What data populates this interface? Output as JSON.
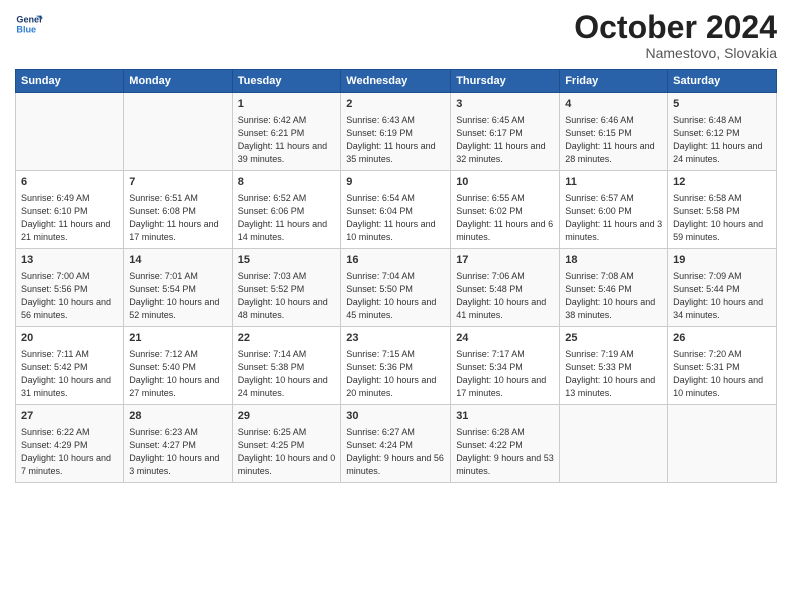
{
  "header": {
    "logo_line1": "General",
    "logo_line2": "Blue",
    "month": "October 2024",
    "location": "Namestovo, Slovakia"
  },
  "days_of_week": [
    "Sunday",
    "Monday",
    "Tuesday",
    "Wednesday",
    "Thursday",
    "Friday",
    "Saturday"
  ],
  "weeks": [
    [
      {
        "day": "",
        "sunrise": "",
        "sunset": "",
        "daylight": ""
      },
      {
        "day": "",
        "sunrise": "",
        "sunset": "",
        "daylight": ""
      },
      {
        "day": "1",
        "sunrise": "Sunrise: 6:42 AM",
        "sunset": "Sunset: 6:21 PM",
        "daylight": "Daylight: 11 hours and 39 minutes."
      },
      {
        "day": "2",
        "sunrise": "Sunrise: 6:43 AM",
        "sunset": "Sunset: 6:19 PM",
        "daylight": "Daylight: 11 hours and 35 minutes."
      },
      {
        "day": "3",
        "sunrise": "Sunrise: 6:45 AM",
        "sunset": "Sunset: 6:17 PM",
        "daylight": "Daylight: 11 hours and 32 minutes."
      },
      {
        "day": "4",
        "sunrise": "Sunrise: 6:46 AM",
        "sunset": "Sunset: 6:15 PM",
        "daylight": "Daylight: 11 hours and 28 minutes."
      },
      {
        "day": "5",
        "sunrise": "Sunrise: 6:48 AM",
        "sunset": "Sunset: 6:12 PM",
        "daylight": "Daylight: 11 hours and 24 minutes."
      }
    ],
    [
      {
        "day": "6",
        "sunrise": "Sunrise: 6:49 AM",
        "sunset": "Sunset: 6:10 PM",
        "daylight": "Daylight: 11 hours and 21 minutes."
      },
      {
        "day": "7",
        "sunrise": "Sunrise: 6:51 AM",
        "sunset": "Sunset: 6:08 PM",
        "daylight": "Daylight: 11 hours and 17 minutes."
      },
      {
        "day": "8",
        "sunrise": "Sunrise: 6:52 AM",
        "sunset": "Sunset: 6:06 PM",
        "daylight": "Daylight: 11 hours and 14 minutes."
      },
      {
        "day": "9",
        "sunrise": "Sunrise: 6:54 AM",
        "sunset": "Sunset: 6:04 PM",
        "daylight": "Daylight: 11 hours and 10 minutes."
      },
      {
        "day": "10",
        "sunrise": "Sunrise: 6:55 AM",
        "sunset": "Sunset: 6:02 PM",
        "daylight": "Daylight: 11 hours and 6 minutes."
      },
      {
        "day": "11",
        "sunrise": "Sunrise: 6:57 AM",
        "sunset": "Sunset: 6:00 PM",
        "daylight": "Daylight: 11 hours and 3 minutes."
      },
      {
        "day": "12",
        "sunrise": "Sunrise: 6:58 AM",
        "sunset": "Sunset: 5:58 PM",
        "daylight": "Daylight: 10 hours and 59 minutes."
      }
    ],
    [
      {
        "day": "13",
        "sunrise": "Sunrise: 7:00 AM",
        "sunset": "Sunset: 5:56 PM",
        "daylight": "Daylight: 10 hours and 56 minutes."
      },
      {
        "day": "14",
        "sunrise": "Sunrise: 7:01 AM",
        "sunset": "Sunset: 5:54 PM",
        "daylight": "Daylight: 10 hours and 52 minutes."
      },
      {
        "day": "15",
        "sunrise": "Sunrise: 7:03 AM",
        "sunset": "Sunset: 5:52 PM",
        "daylight": "Daylight: 10 hours and 48 minutes."
      },
      {
        "day": "16",
        "sunrise": "Sunrise: 7:04 AM",
        "sunset": "Sunset: 5:50 PM",
        "daylight": "Daylight: 10 hours and 45 minutes."
      },
      {
        "day": "17",
        "sunrise": "Sunrise: 7:06 AM",
        "sunset": "Sunset: 5:48 PM",
        "daylight": "Daylight: 10 hours and 41 minutes."
      },
      {
        "day": "18",
        "sunrise": "Sunrise: 7:08 AM",
        "sunset": "Sunset: 5:46 PM",
        "daylight": "Daylight: 10 hours and 38 minutes."
      },
      {
        "day": "19",
        "sunrise": "Sunrise: 7:09 AM",
        "sunset": "Sunset: 5:44 PM",
        "daylight": "Daylight: 10 hours and 34 minutes."
      }
    ],
    [
      {
        "day": "20",
        "sunrise": "Sunrise: 7:11 AM",
        "sunset": "Sunset: 5:42 PM",
        "daylight": "Daylight: 10 hours and 31 minutes."
      },
      {
        "day": "21",
        "sunrise": "Sunrise: 7:12 AM",
        "sunset": "Sunset: 5:40 PM",
        "daylight": "Daylight: 10 hours and 27 minutes."
      },
      {
        "day": "22",
        "sunrise": "Sunrise: 7:14 AM",
        "sunset": "Sunset: 5:38 PM",
        "daylight": "Daylight: 10 hours and 24 minutes."
      },
      {
        "day": "23",
        "sunrise": "Sunrise: 7:15 AM",
        "sunset": "Sunset: 5:36 PM",
        "daylight": "Daylight: 10 hours and 20 minutes."
      },
      {
        "day": "24",
        "sunrise": "Sunrise: 7:17 AM",
        "sunset": "Sunset: 5:34 PM",
        "daylight": "Daylight: 10 hours and 17 minutes."
      },
      {
        "day": "25",
        "sunrise": "Sunrise: 7:19 AM",
        "sunset": "Sunset: 5:33 PM",
        "daylight": "Daylight: 10 hours and 13 minutes."
      },
      {
        "day": "26",
        "sunrise": "Sunrise: 7:20 AM",
        "sunset": "Sunset: 5:31 PM",
        "daylight": "Daylight: 10 hours and 10 minutes."
      }
    ],
    [
      {
        "day": "27",
        "sunrise": "Sunrise: 6:22 AM",
        "sunset": "Sunset: 4:29 PM",
        "daylight": "Daylight: 10 hours and 7 minutes."
      },
      {
        "day": "28",
        "sunrise": "Sunrise: 6:23 AM",
        "sunset": "Sunset: 4:27 PM",
        "daylight": "Daylight: 10 hours and 3 minutes."
      },
      {
        "day": "29",
        "sunrise": "Sunrise: 6:25 AM",
        "sunset": "Sunset: 4:25 PM",
        "daylight": "Daylight: 10 hours and 0 minutes."
      },
      {
        "day": "30",
        "sunrise": "Sunrise: 6:27 AM",
        "sunset": "Sunset: 4:24 PM",
        "daylight": "Daylight: 9 hours and 56 minutes."
      },
      {
        "day": "31",
        "sunrise": "Sunrise: 6:28 AM",
        "sunset": "Sunset: 4:22 PM",
        "daylight": "Daylight: 9 hours and 53 minutes."
      },
      {
        "day": "",
        "sunrise": "",
        "sunset": "",
        "daylight": ""
      },
      {
        "day": "",
        "sunrise": "",
        "sunset": "",
        "daylight": ""
      }
    ]
  ]
}
